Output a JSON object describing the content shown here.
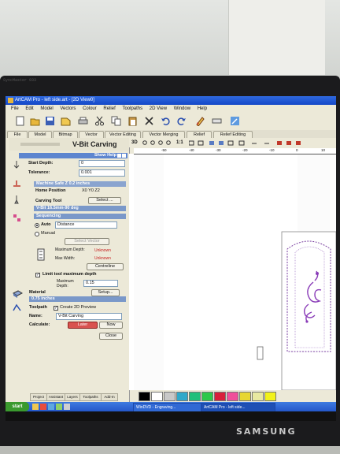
{
  "monitor": {
    "bezel_label": "SyncMaster 933",
    "brand": "SAMSUNG"
  },
  "window": {
    "title": "ArtCAM Pro - left side.art - [2D View0]"
  },
  "menu": [
    "File",
    "Edit",
    "Model",
    "Vectors",
    "Colour",
    "Relief",
    "Toolpaths",
    "2D View",
    "Window",
    "Help"
  ],
  "tabs": [
    "File",
    "Model",
    "Bitmap",
    "Vector",
    "Vector Editing",
    "Vector Merging",
    "Relief",
    "Relief Editing"
  ],
  "view_toolbar": {
    "label": "3D",
    "ratio": "1:1"
  },
  "panel": {
    "title": "V-Bit Carving",
    "show_help": "Show Help",
    "start_depth_label": "Start Depth:",
    "start_depth_value": "0",
    "tolerance_label": "Tolerance:",
    "tolerance_value": "0.001",
    "machine_safe": "Machine Safe Z 0.2 inches",
    "home_position_label": "Home Position",
    "home_position_value": "X0 Y0 Z2",
    "carving_tool_label": "Carving Tool",
    "select_label": "Select ...",
    "tool_value": "V-Bit 16.5mm-90 deg",
    "sequencing": "Sequencing",
    "auto_label": "Auto",
    "auto_value": "Distance",
    "manual_label": "Manual",
    "select_vector": "Select Vector",
    "max_depth_label": "Maximum Depth:",
    "max_depth_value": "Unknown",
    "max_width_label": "Max Width:",
    "max_width_value": "Unknown",
    "centreline": "Centreline",
    "limit_label": "Limit tool maximum depth",
    "limit_max_label": "Maximum Depth:",
    "limit_max_value": "0.15",
    "material_label": "Material",
    "material_value": "0.75 inches",
    "setup_label": "Setup...",
    "toolpath_label": "Toolpath",
    "preview_label": "Create 2D Preview",
    "name_label": "Name:",
    "name_value": "V-Bit Carving",
    "calculate_label": "Calculate:",
    "later_label": "Later",
    "now_label": "Now",
    "close_label": "Close",
    "bottom_tabs": [
      "Project",
      "Assistant",
      "Layers",
      "Toolpaths",
      "Add-In"
    ]
  },
  "ruler": {
    "ticks": [
      "-50",
      "-40",
      "-30",
      "-20",
      "-10",
      "0",
      "10"
    ]
  },
  "palette": {
    "colors": [
      "#000000",
      "#ffffff",
      "#c8c8c8",
      "#2fa8c9",
      "#1fbf7a",
      "#2ec84a",
      "#d81f3a",
      "#ef4f9a",
      "#e7d631",
      "#e8e8a0",
      "#f2f21a"
    ]
  },
  "taskbar": {
    "start": "start",
    "tasks": [
      "WinDVD - Engraving...",
      "ArtCAM Pro - left side..."
    ]
  }
}
